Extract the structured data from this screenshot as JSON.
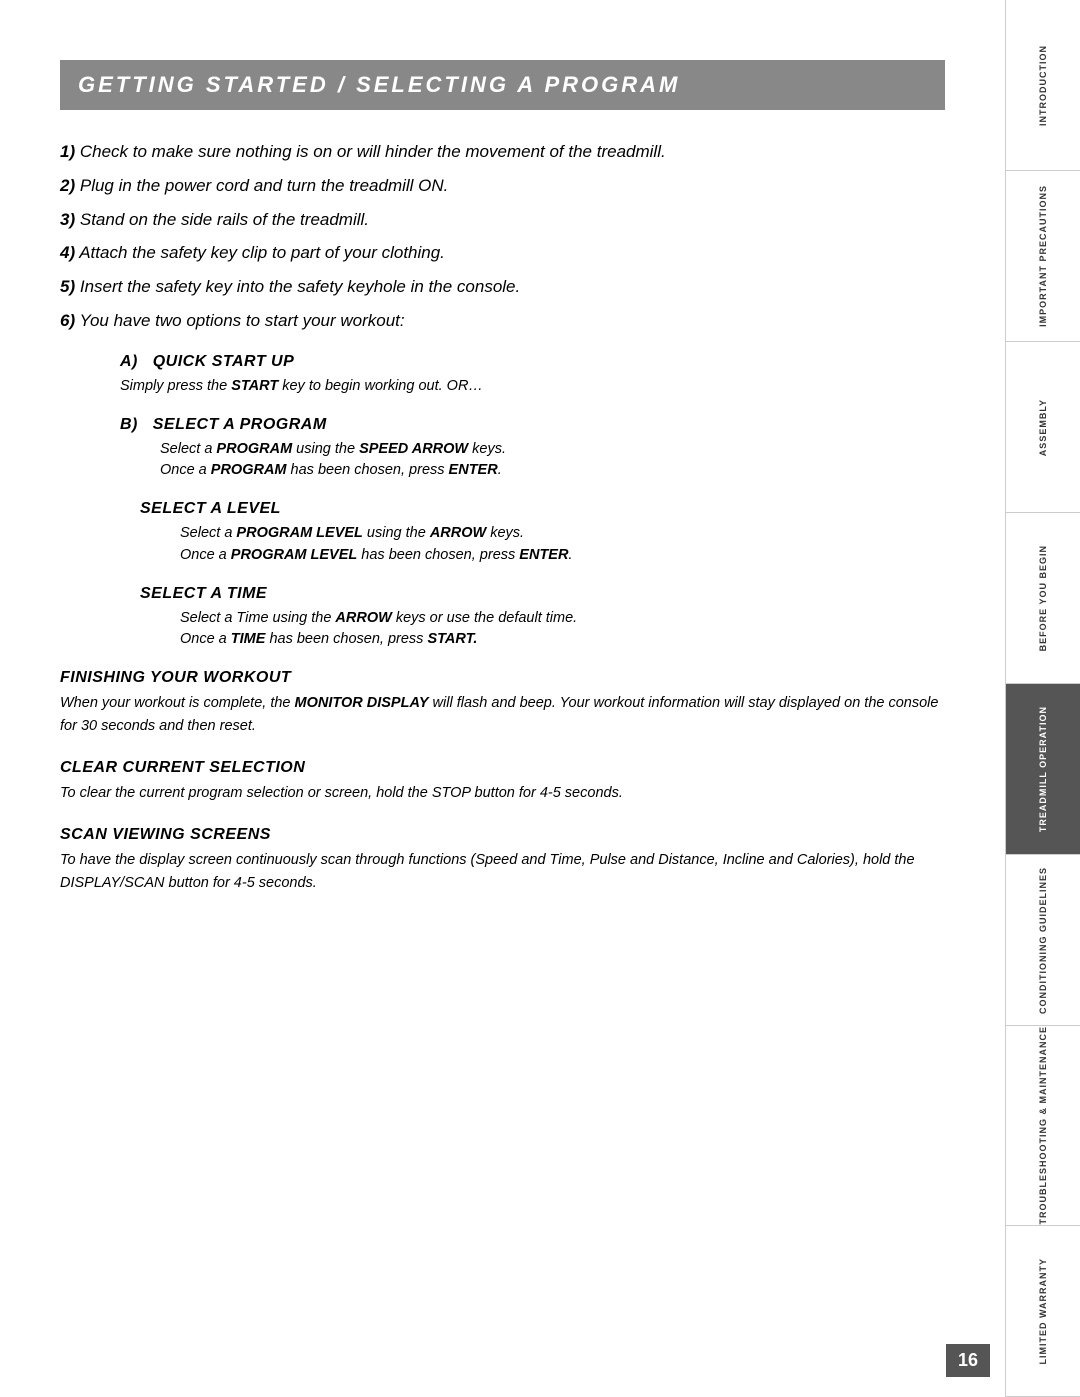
{
  "header": {
    "title": "GETTING STARTED / SELECTING A PROGRAM"
  },
  "steps": [
    {
      "num": "1)",
      "text": "Check to make sure nothing is on or will hinder the movement of the treadmill."
    },
    {
      "num": "2)",
      "text": "Plug in the power cord and turn the treadmill ON."
    },
    {
      "num": "3)",
      "text": "Stand on the side rails of the treadmill."
    },
    {
      "num": "4)",
      "text": "Attach the safety key clip to part of your clothing."
    },
    {
      "num": "5)",
      "text": "Insert the safety key into the safety keyhole in the console."
    },
    {
      "num": "6)",
      "text": "You have two options to start your workout:"
    }
  ],
  "subsections": {
    "a": {
      "letter": "A)",
      "title": "QUICK START UP",
      "body": "Simply press the START key to begin working out. OR…"
    },
    "b": {
      "letter": "B)",
      "title": "SELECT A PROGRAM",
      "line1": "Select a PROGRAM using the SPEED ARROW keys.",
      "line2": "Once a PROGRAM has been chosen, press ENTER."
    },
    "level": {
      "title": "SELECT A LEVEL",
      "line1": "Select a PROGRAM LEVEL using the ARROW keys.",
      "line2": "Once a PROGRAM LEVEL has been chosen, press ENTER."
    },
    "time": {
      "title": "SELECT A TIME",
      "line1": "Select a Time using the ARROW keys or use the default time.",
      "line2": "Once a TIME has been chosen, press START."
    }
  },
  "sections": {
    "finishing": {
      "title": "FINISHING YOUR WORKOUT",
      "body": "When your workout is complete, the MONITOR DISPLAY will flash and beep. Your workout information will stay displayed on the console for 30 seconds and then reset."
    },
    "clear": {
      "title": "CLEAR CURRENT SELECTION",
      "body": "To clear the current program selection or screen, hold the STOP button for 4-5 seconds."
    },
    "scan": {
      "title": "SCAN VIEWING SCREENS",
      "body": "To have the display screen continuously scan through functions (Speed and Time, Pulse and Distance, Incline and Calories), hold the DISPLAY/SCAN button for 4-5 seconds."
    }
  },
  "sidebar": {
    "items": [
      {
        "label": "INTRODUCTION",
        "active": false
      },
      {
        "label": "IMPORTANT\nPRECAUTIONS",
        "active": false
      },
      {
        "label": "ASSEMBLY",
        "active": false
      },
      {
        "label": "BEFORE\nYOU BEGIN",
        "active": false
      },
      {
        "label": "TREADMILL\nOPERATION",
        "active": true
      },
      {
        "label": "CONDITIONING\nGUIDELINES",
        "active": false
      },
      {
        "label": "TROUBLESHOOTING\n& MAINTENANCE",
        "active": false
      },
      {
        "label": "LIMITED\nWARRANTY",
        "active": false
      }
    ]
  },
  "page_number": "16"
}
